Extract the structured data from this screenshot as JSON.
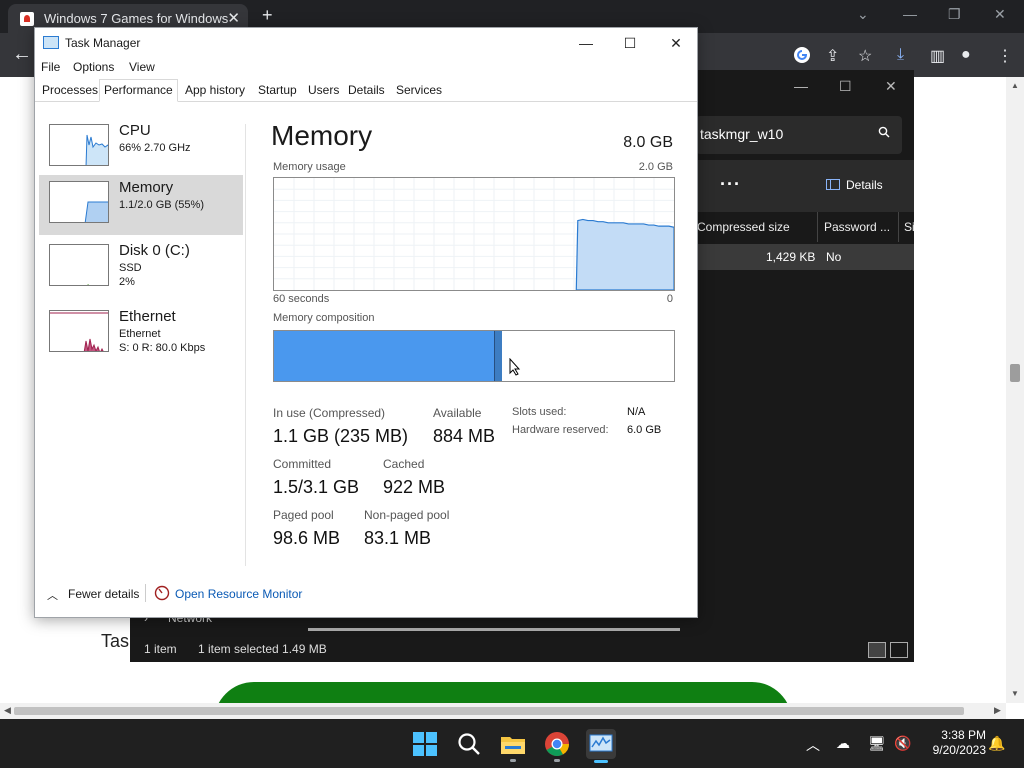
{
  "browser": {
    "tab_title": "Windows 7 Games for Windows",
    "page_fragment": "Tas"
  },
  "explorer": {
    "search_value": "taskmgr_w10",
    "details_label": "Details",
    "columns": [
      "Compressed size",
      "Password ...",
      "Si"
    ],
    "row": {
      "compressed_size": "1,429 KB",
      "password": "No"
    },
    "nav_item": "Network",
    "status": {
      "count": "1 item",
      "selected": "1 item selected  1.49 MB"
    }
  },
  "taskmanager": {
    "title": "Task Manager",
    "menu": [
      "File",
      "Options",
      "View"
    ],
    "tabs": [
      "Processes",
      "Performance",
      "App history",
      "Startup",
      "Users",
      "Details",
      "Services"
    ],
    "active_tab": "Performance",
    "sidebar": [
      {
        "name": "CPU",
        "sub1": "66%  2.70 GHz",
        "sub2": ""
      },
      {
        "name": "Memory",
        "sub1": "1.1/2.0 GB (55%)",
        "sub2": ""
      },
      {
        "name": "Disk 0 (C:)",
        "sub1": "SSD",
        "sub2": "2%"
      },
      {
        "name": "Ethernet",
        "sub1": "Ethernet",
        "sub2": "S: 0  R: 80.0 Kbps"
      }
    ],
    "memory": {
      "heading": "Memory",
      "total": "8.0 GB",
      "usage_label": "Memory usage",
      "usage_max": "2.0 GB",
      "time_left": "60 seconds",
      "time_right": "0",
      "composition_label": "Memory composition",
      "composition_in_use_fraction": 0.55,
      "composition_modified_fraction": 0.02,
      "usage_history": [
        0,
        0,
        0,
        0,
        0,
        0,
        0,
        0,
        0,
        0,
        0,
        0,
        0,
        0,
        0,
        0,
        0,
        0,
        0,
        0,
        0,
        0,
        0,
        0,
        0,
        0,
        0,
        0,
        0,
        0,
        0,
        0,
        0,
        0,
        0,
        0,
        0,
        0,
        0,
        0,
        0,
        0,
        0,
        0,
        0,
        0,
        0,
        0,
        0,
        0,
        0,
        0,
        0,
        0,
        0,
        0,
        0,
        0,
        0,
        0,
        0.62,
        0.63,
        0.62,
        0.62,
        0.61,
        0.61,
        0.6,
        0.6,
        0.6,
        0.6,
        0.59,
        0.59,
        0.59,
        0.59,
        0.58,
        0.58,
        0.57,
        0.57,
        0.57,
        0.56
      ],
      "stats": {
        "in_use_label": "In use (Compressed)",
        "in_use_value": "1.1 GB (235 MB)",
        "available_label": "Available",
        "available_value": "884 MB",
        "committed_label": "Committed",
        "committed_value": "1.5/3.1 GB",
        "cached_label": "Cached",
        "cached_value": "922 MB",
        "paged_label": "Paged pool",
        "paged_value": "98.6 MB",
        "nonpaged_label": "Non-paged pool",
        "nonpaged_value": "83.1 MB",
        "slots_label": "Slots used:",
        "slots_value": "N/A",
        "hw_label": "Hardware reserved:",
        "hw_value": "6.0 GB"
      }
    },
    "footer": {
      "fewer_details": "Fewer details",
      "resource_monitor": "Open Resource Monitor"
    }
  },
  "taskbar": {
    "time": "3:38 PM",
    "date": "9/20/2023"
  },
  "colors": {
    "memory_fill": "#4a98ee",
    "memory_graph": "#c3dcf6",
    "memory_line": "#2b7bd1",
    "ethernet": "#a0204e",
    "disk": "#4c9a2a",
    "explorer_bg": "#191919",
    "taskbar_bg": "#202020"
  }
}
